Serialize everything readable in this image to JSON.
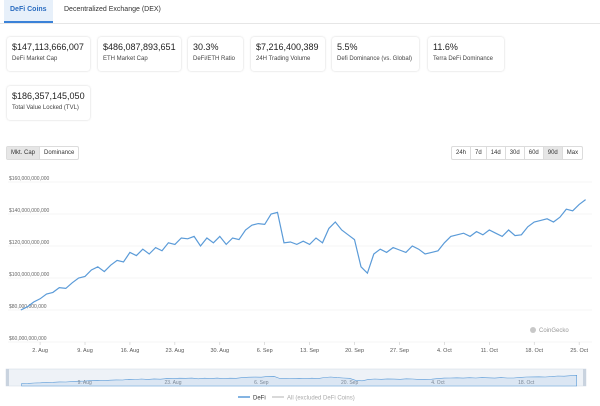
{
  "tabs": [
    {
      "label": "DeFi Coins",
      "active": true
    },
    {
      "label": "Decentralized Exchange (DEX)",
      "active": false
    }
  ],
  "stats": [
    {
      "value": "$147,113,666,007",
      "label": "DeFi Market Cap"
    },
    {
      "value": "$486,087,893,651",
      "label": "ETH Market Cap"
    },
    {
      "value": "30.3%",
      "label": "DeFi/ETH Ratio"
    },
    {
      "value": "$7,216,400,389",
      "label": "24H Trading Volume"
    },
    {
      "value": "5.5%",
      "label": "Defi Dominance (vs. Global)"
    },
    {
      "value": "11.6%",
      "label": "Terra DeFi Dominance"
    },
    {
      "value": "$186,357,145,050",
      "label": "Total Value Locked (TVL)"
    }
  ],
  "metric_toggle": [
    {
      "label": "Mkt. Cap",
      "selected": true
    },
    {
      "label": "Dominance",
      "selected": false
    }
  ],
  "ranges": [
    {
      "label": "24h",
      "selected": false
    },
    {
      "label": "7d",
      "selected": false
    },
    {
      "label": "14d",
      "selected": false
    },
    {
      "label": "30d",
      "selected": false
    },
    {
      "label": "60d",
      "selected": false
    },
    {
      "label": "90d",
      "selected": true
    },
    {
      "label": "Max",
      "selected": false
    }
  ],
  "watermark": "CoinGecko",
  "colors": {
    "line": "#5b9bd8",
    "accent": "#3b82d8",
    "nav_fill": "#dbe6f3"
  },
  "chart_data": {
    "type": "line",
    "yticks": [
      "$160,000,000,000",
      "$140,000,000,000",
      "$120,000,000,000",
      "$100,000,000,000",
      "$80,000,000,000",
      "$60,000,000,000"
    ],
    "ylim": [
      60000000000,
      160000000000
    ],
    "xticks": [
      {
        "label": "2. Aug",
        "day": 2
      },
      {
        "label": "9. Aug",
        "day": 9
      },
      {
        "label": "16. Aug",
        "day": 16
      },
      {
        "label": "23. Aug",
        "day": 23
      },
      {
        "label": "30. Aug",
        "day": 30
      },
      {
        "label": "6. Sep",
        "day": 37
      },
      {
        "label": "13. Sep",
        "day": 44
      },
      {
        "label": "20. Sep",
        "day": 51
      },
      {
        "label": "27. Sep",
        "day": 58
      },
      {
        "label": "4. Oct",
        "day": 65
      },
      {
        "label": "11. Oct",
        "day": 72
      },
      {
        "label": "18. Oct",
        "day": 79
      },
      {
        "label": "25. Oct",
        "day": 86
      }
    ],
    "navigator_labels": [
      "9. Aug",
      "23. Aug",
      "6. Sep",
      "20. Sep",
      "4. Oct",
      "18. Oct"
    ],
    "legend": [
      "DeFi",
      "All (excluded DeFi Coins)"
    ],
    "series": [
      {
        "name": "DeFi",
        "points": [
          [
            -1,
            80000000000
          ],
          [
            0,
            82000000000
          ],
          [
            1,
            85000000000
          ],
          [
            2,
            87000000000
          ],
          [
            3,
            90000000000
          ],
          [
            4,
            91000000000
          ],
          [
            5,
            94000000000
          ],
          [
            6,
            93500000000
          ],
          [
            7,
            97000000000
          ],
          [
            8,
            100000000000
          ],
          [
            9,
            101000000000
          ],
          [
            10,
            105000000000
          ],
          [
            11,
            107000000000
          ],
          [
            12,
            104000000000
          ],
          [
            13,
            108000000000
          ],
          [
            14,
            111000000000
          ],
          [
            15,
            110000000000
          ],
          [
            16,
            116000000000
          ],
          [
            17,
            114000000000
          ],
          [
            18,
            118000000000
          ],
          [
            19,
            115000000000
          ],
          [
            20,
            119000000000
          ],
          [
            21,
            117000000000
          ],
          [
            22,
            122000000000
          ],
          [
            23,
            121000000000
          ],
          [
            24,
            125000000000
          ],
          [
            25,
            124500000000
          ],
          [
            26,
            126000000000
          ],
          [
            27,
            120000000000
          ],
          [
            28,
            125000000000
          ],
          [
            29,
            122000000000
          ],
          [
            30,
            126000000000
          ],
          [
            31,
            121000000000
          ],
          [
            32,
            125000000000
          ],
          [
            33,
            124000000000
          ],
          [
            34,
            130000000000
          ],
          [
            35,
            133000000000
          ],
          [
            36,
            134000000000
          ],
          [
            37,
            133500000000
          ],
          [
            38,
            140000000000
          ],
          [
            39,
            141000000000
          ],
          [
            40,
            122000000000
          ],
          [
            41,
            122500000000
          ],
          [
            42,
            121000000000
          ],
          [
            43,
            123000000000
          ],
          [
            44,
            121000000000
          ],
          [
            45,
            125000000000
          ],
          [
            46,
            122000000000
          ],
          [
            47,
            131000000000
          ],
          [
            48,
            135000000000
          ],
          [
            49,
            130000000000
          ],
          [
            50,
            127000000000
          ],
          [
            51,
            124000000000
          ],
          [
            52,
            107000000000
          ],
          [
            53,
            103000000000
          ],
          [
            54,
            115000000000
          ],
          [
            55,
            118000000000
          ],
          [
            56,
            116000000000
          ],
          [
            57,
            119000000000
          ],
          [
            58,
            117500000000
          ],
          [
            59,
            116000000000
          ],
          [
            60,
            120000000000
          ],
          [
            61,
            118000000000
          ],
          [
            62,
            115000000000
          ],
          [
            63,
            116000000000
          ],
          [
            64,
            117000000000
          ],
          [
            65,
            122000000000
          ],
          [
            66,
            126000000000
          ],
          [
            67,
            127000000000
          ],
          [
            68,
            128000000000
          ],
          [
            69,
            126000000000
          ],
          [
            70,
            129000000000
          ],
          [
            71,
            127000000000
          ],
          [
            72,
            130000000000
          ],
          [
            73,
            128000000000
          ],
          [
            74,
            126000000000
          ],
          [
            75,
            130000000000
          ],
          [
            76,
            126500000000
          ],
          [
            77,
            127000000000
          ],
          [
            78,
            132000000000
          ],
          [
            79,
            135000000000
          ],
          [
            80,
            136000000000
          ],
          [
            81,
            137000000000
          ],
          [
            82,
            135000000000
          ],
          [
            83,
            138000000000
          ],
          [
            84,
            143000000000
          ],
          [
            85,
            142000000000
          ],
          [
            86,
            146000000000
          ],
          [
            87,
            149000000000
          ]
        ]
      }
    ]
  }
}
